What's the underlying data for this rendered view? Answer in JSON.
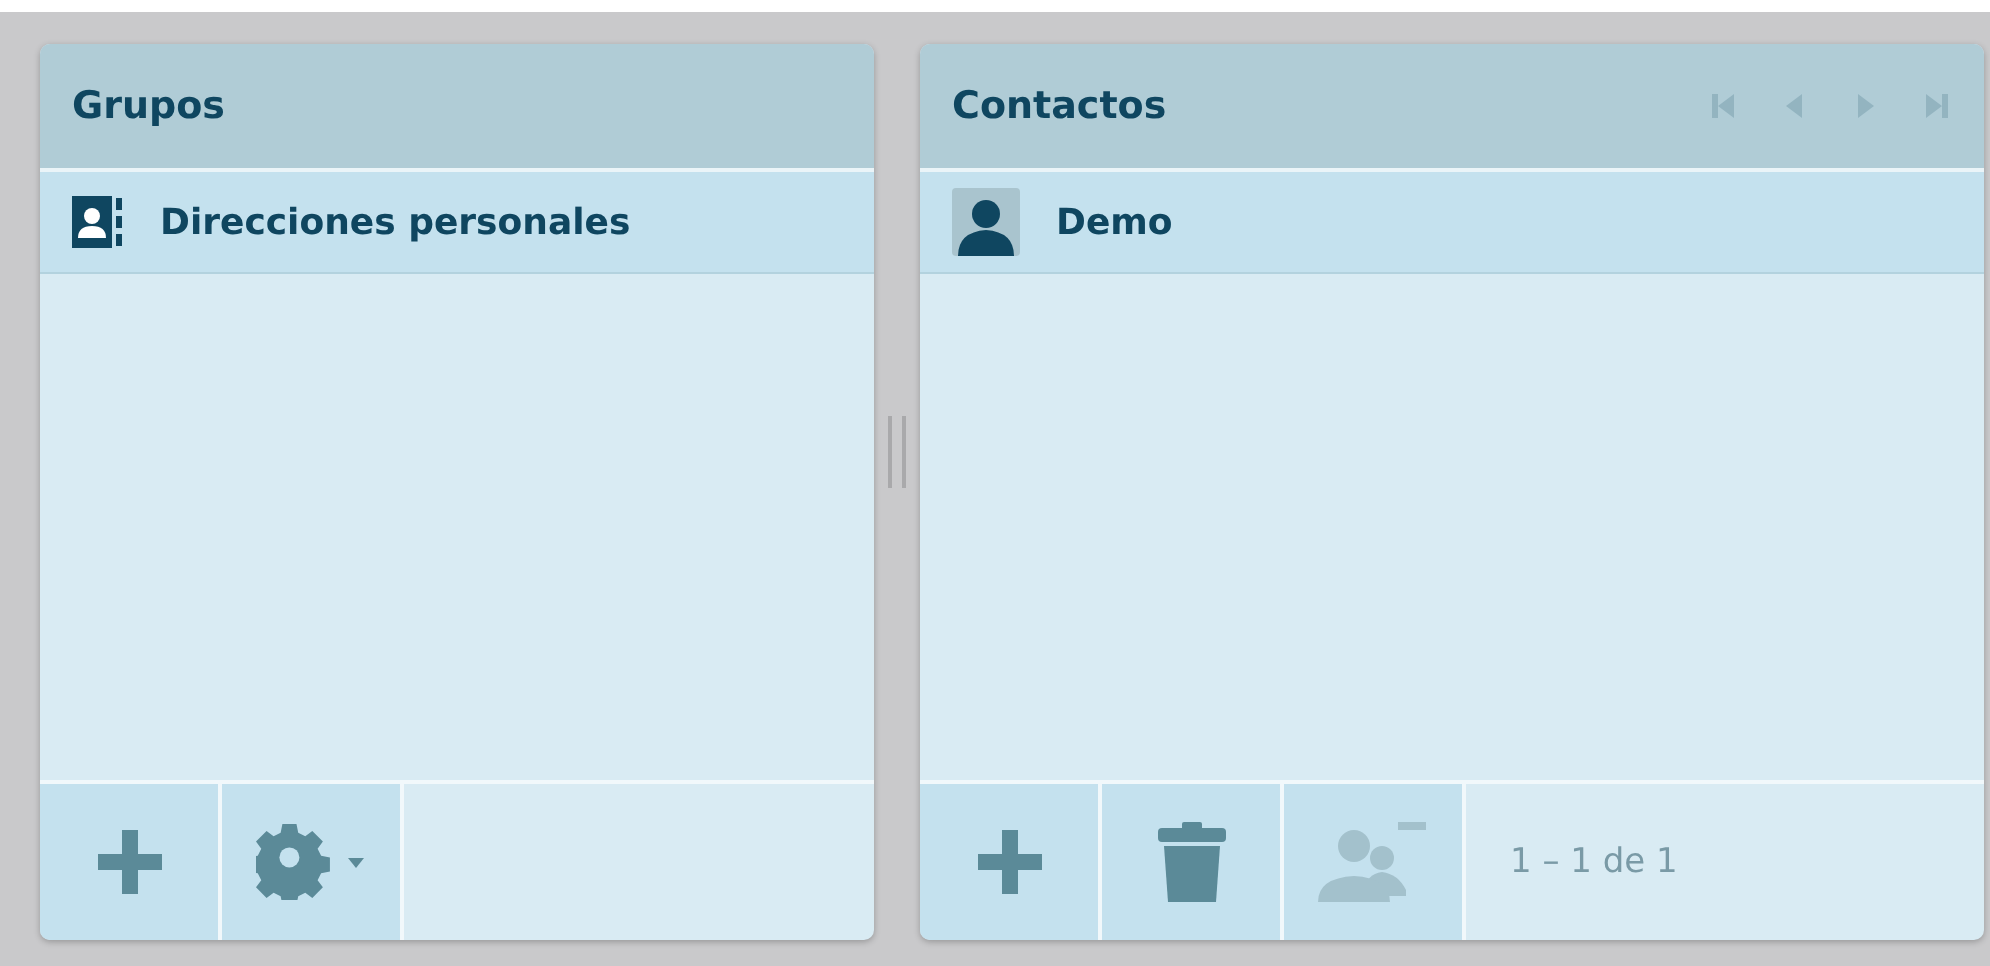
{
  "groups": {
    "title": "Grupos",
    "items": [
      {
        "label": "Direcciones personales",
        "selected": true
      }
    ],
    "footer_buttons": [
      {
        "kind": "add",
        "disabled": false
      },
      {
        "kind": "settings",
        "disabled": false
      }
    ]
  },
  "contacts": {
    "title": "Contactos",
    "pager": [
      {
        "kind": "first",
        "disabled": true
      },
      {
        "kind": "prev",
        "disabled": true
      },
      {
        "kind": "next",
        "disabled": true
      },
      {
        "kind": "last",
        "disabled": true
      }
    ],
    "items": [
      {
        "label": "Demo",
        "selected": true
      }
    ],
    "footer_buttons": [
      {
        "kind": "add",
        "disabled": false
      },
      {
        "kind": "delete",
        "disabled": false
      },
      {
        "kind": "remove-from-group",
        "disabled": true
      }
    ],
    "count": "1 – 1 de 1"
  }
}
